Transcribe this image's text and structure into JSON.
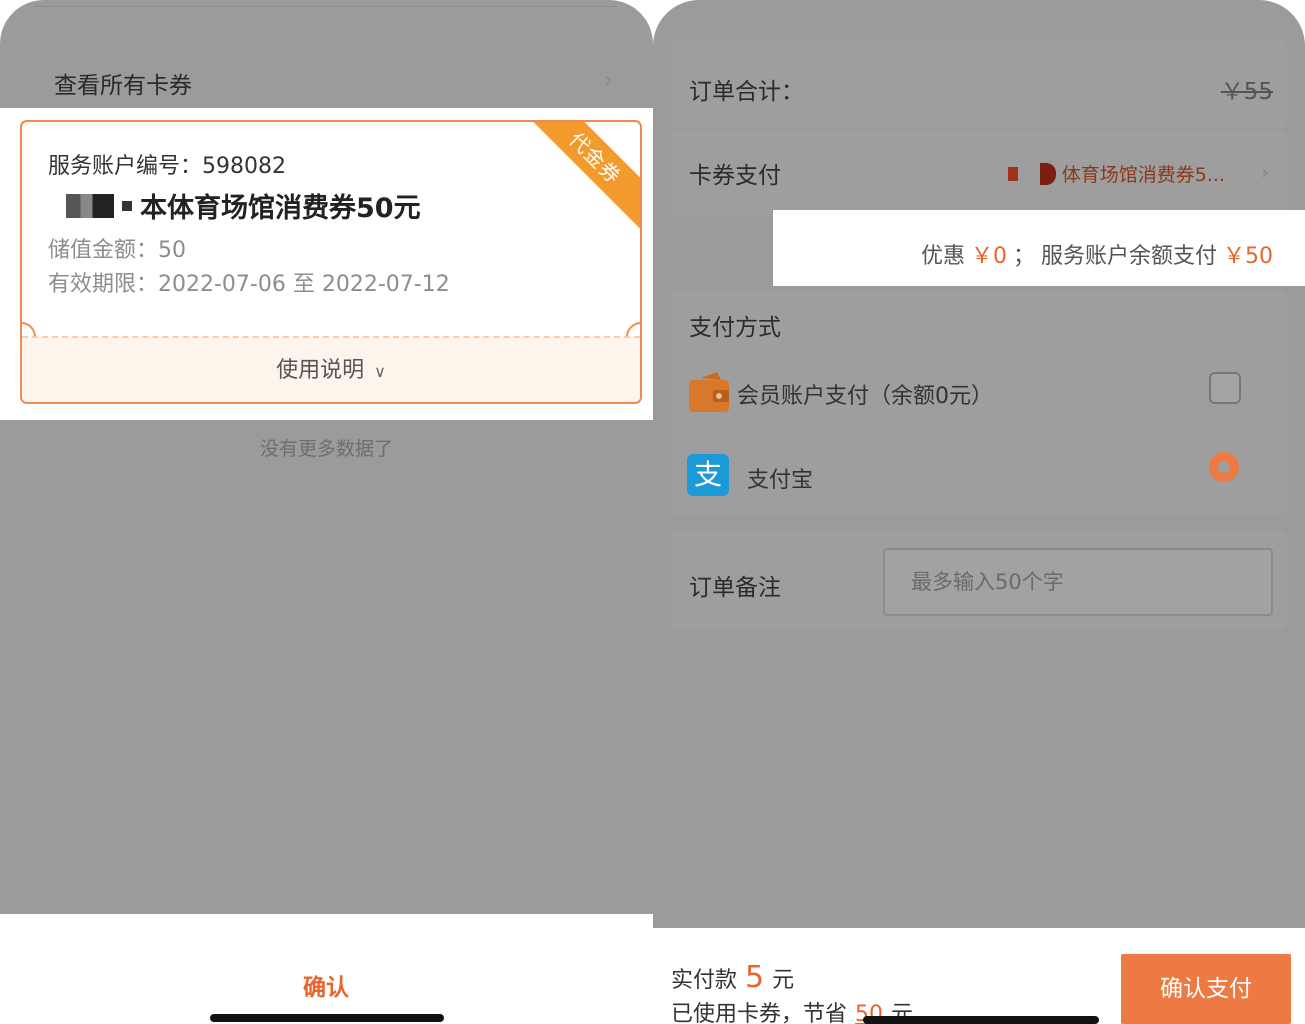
{
  "left": {
    "header_link": "查看所有卡券",
    "header_chevron": "chevron-right-icon",
    "coupon": {
      "ribbon": "代金券",
      "service_account_no": "服务账户编号：598082",
      "name": "本体育场馆消费券50元",
      "stored_amount": "储值金额：50",
      "validity": "有效期限：2022-07-06 至 2022-07-12",
      "usage_label": "使用说明"
    },
    "no_more_data": "没有更多数据了",
    "confirm_label": "确认"
  },
  "right": {
    "order_total_label": "订单合计：",
    "order_total_value": "￥55",
    "coupon_pay_label": "卡券支付",
    "coupon_pay_value": "体育场馆消费券5...",
    "discount_text": "优惠",
    "discount_value": "￥0",
    "separator": "；",
    "balance_pay_text": "服务账户余额支付",
    "balance_pay_value": "￥50",
    "pay_method_title": "支付方式",
    "member_pay_label": "会员账户支付（余额0元）",
    "alipay_label": "支付宝",
    "alipay_glyph": "支",
    "remark_label": "订单备注",
    "remark_placeholder": "最多输入50个字",
    "actual_pay_prefix": "实付款",
    "actual_pay_amount": "5",
    "actual_pay_unit": "元",
    "saved_prefix": "已使用卡券，节省",
    "saved_amount": "50",
    "saved_unit": "元",
    "pay_button": "确认支付"
  },
  "colors": {
    "accent": "#ee7a43",
    "ribbon": "#f39a2d",
    "overlay": "#9b9b9b",
    "alipay": "#1a9ad6"
  }
}
